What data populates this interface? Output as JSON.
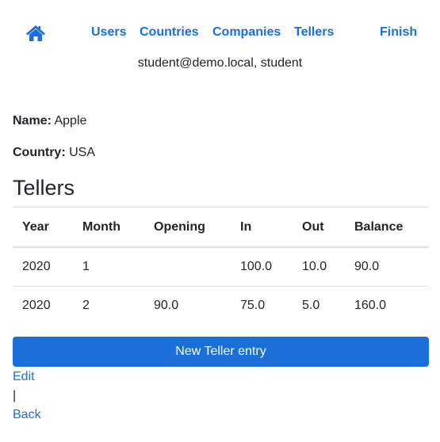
{
  "nav": {
    "home_icon": "home-icon",
    "items": [
      {
        "label": "Users"
      },
      {
        "label": "Countries"
      },
      {
        "label": "Companies"
      },
      {
        "label": "Tellers"
      }
    ],
    "finish_label": "Finish"
  },
  "user_info": "student@demo.local, student",
  "company": {
    "name_label": "Name:",
    "name_value": "Apple",
    "country_label": "Country:",
    "country_value": "USA"
  },
  "section_title": "Tellers",
  "table": {
    "headers": [
      "Year",
      "Month",
      "Opening",
      "In",
      "Out",
      "Balance"
    ],
    "rows": [
      [
        "2020",
        "1",
        "",
        "100.0",
        "10.0",
        "90.0"
      ],
      [
        "2020",
        "2",
        "90.0",
        "75.0",
        "5.0",
        "160.0"
      ]
    ]
  },
  "actions": {
    "new_label": "New Teller entry",
    "edit_label": "Edit",
    "separator": "|",
    "back_label": "Back"
  },
  "colors": {
    "link": "#1a6fd8",
    "button_bg": "#1a6fd8",
    "button_text": "#ffffff",
    "border": "#dee2e6"
  }
}
